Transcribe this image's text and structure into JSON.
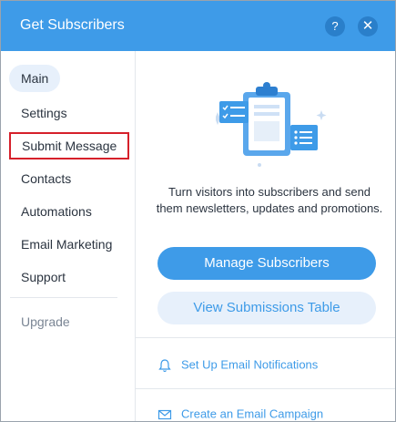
{
  "header": {
    "title": "Get Subscribers",
    "help_symbol": "?",
    "close_symbol": "✕"
  },
  "sidebar": {
    "items": [
      {
        "label": "Main"
      },
      {
        "label": "Settings"
      },
      {
        "label": "Submit Message"
      },
      {
        "label": "Contacts"
      },
      {
        "label": "Automations"
      },
      {
        "label": "Email Marketing"
      },
      {
        "label": "Support"
      }
    ],
    "upgrade": "Upgrade"
  },
  "main": {
    "description": "Turn visitors into subscribers and send them newsletters, updates and promotions.",
    "primary_button": "Manage Subscribers",
    "secondary_button": "View Submissions Table",
    "links": [
      {
        "label": "Set Up Email Notifications",
        "icon": "bell-icon"
      },
      {
        "label": "Create an Email Campaign",
        "icon": "envelope-icon"
      }
    ]
  },
  "colors": {
    "accent": "#3e9be8",
    "active_bg": "#e7f0fb",
    "highlight_border": "#d6202a"
  }
}
